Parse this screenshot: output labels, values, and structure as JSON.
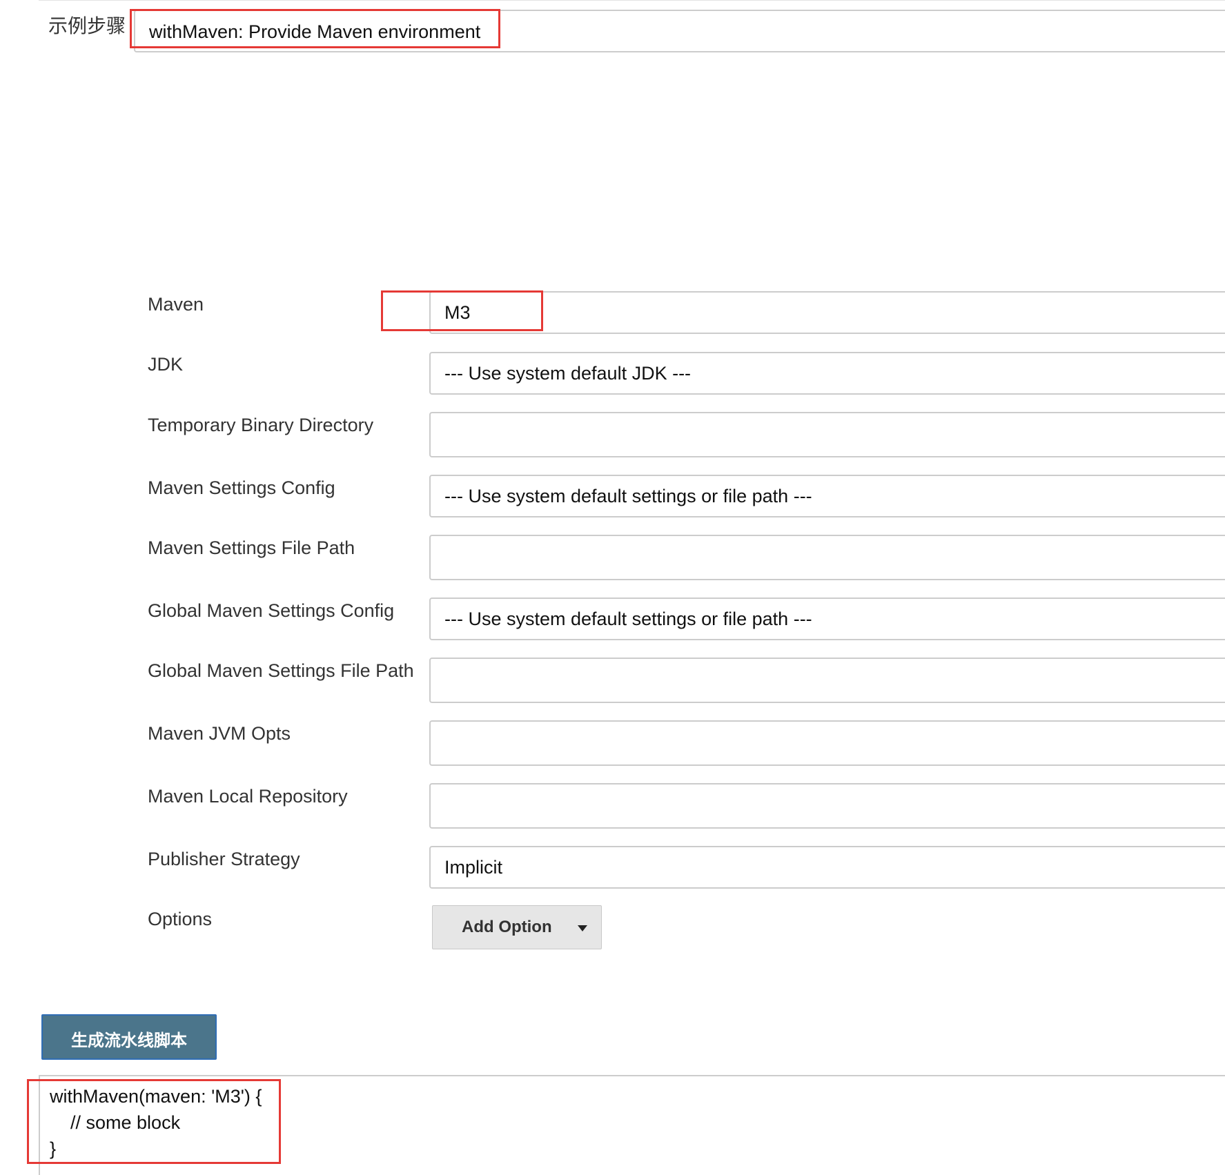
{
  "sample_step": {
    "label": "示例步骤",
    "selected": "withMaven: Provide Maven environment"
  },
  "form": {
    "maven": {
      "label": "Maven",
      "value": "M3"
    },
    "jdk": {
      "label": "JDK",
      "value": "--- Use system default JDK ---"
    },
    "temp_binary_dir": {
      "label": "Temporary Binary Directory",
      "value": ""
    },
    "maven_settings_config": {
      "label": "Maven Settings Config",
      "value": "--- Use system default settings or file path ---"
    },
    "maven_settings_file_path": {
      "label": "Maven Settings File Path",
      "value": ""
    },
    "global_maven_settings_config": {
      "label": "Global Maven Settings Config",
      "value": "--- Use system default settings or file path ---"
    },
    "global_maven_settings_file_path": {
      "label": "Global Maven Settings File Path",
      "value": ""
    },
    "maven_jvm_opts": {
      "label": "Maven JVM Opts",
      "value": ""
    },
    "maven_local_repository": {
      "label": "Maven Local Repository",
      "value": ""
    },
    "publisher_strategy": {
      "label": "Publisher Strategy",
      "value": "Implicit"
    },
    "options": {
      "label": "Options",
      "button_label": "Add Option"
    }
  },
  "generate_button": {
    "label": "生成流水线脚本"
  },
  "output": {
    "lines": [
      "withMaven(maven: 'M3') {",
      "    // some block",
      "}"
    ]
  },
  "colors": {
    "highlight": "#e53935",
    "generate_button_bg": "#4b758b",
    "field_border": "#cccccc"
  }
}
